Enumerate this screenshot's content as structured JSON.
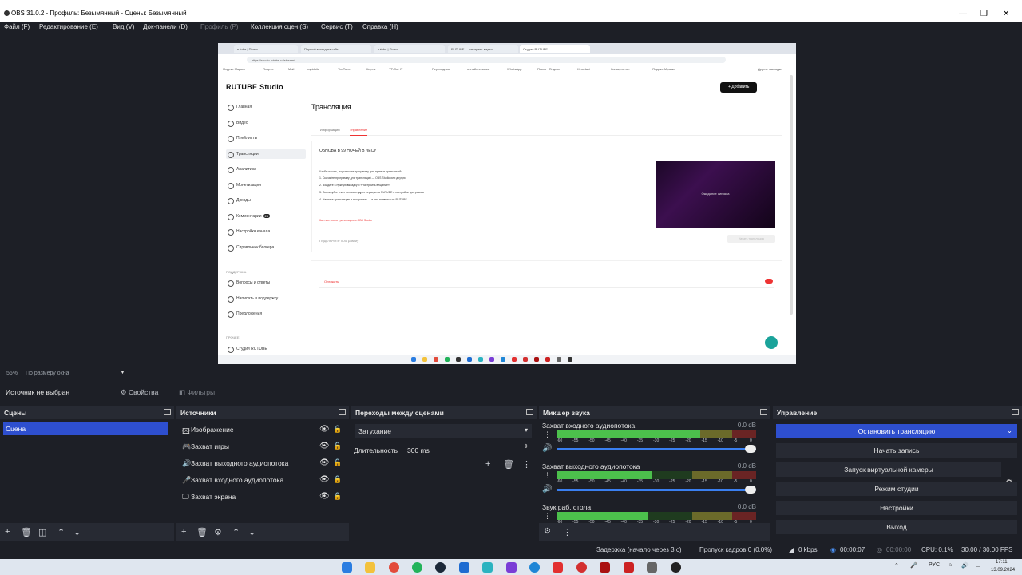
{
  "window": {
    "title": "OBS 31.0.2 - Профиль: Безымянный - Сцены: Безымянный",
    "minimize": "—",
    "maximize": "❐",
    "close": "✕"
  },
  "menu": [
    {
      "label": "Файл (F)",
      "disabled": false
    },
    {
      "label": "Редактирование (E)",
      "disabled": false
    },
    {
      "label": "Вид (V)",
      "disabled": false
    },
    {
      "label": "Док-панели (D)",
      "disabled": false
    },
    {
      "label": "Профиль (P)",
      "disabled": true
    },
    {
      "label": "Коллекция сцен (S)",
      "disabled": false
    },
    {
      "label": "Сервис (T)",
      "disabled": false
    },
    {
      "label": "Справка (H)",
      "disabled": false
    }
  ],
  "capture": {
    "tabs": [
      "rutube | Поиск",
      "Первый взгляд на сайт",
      "rutube | Поиск",
      "RUTUBE — смотреть видео",
      "Студия RUTUBE"
    ],
    "url": "https://studio.rutube.ru/stream/...",
    "bookmarks": [
      "Яндекс Маркет",
      "Яндекс",
      "Mail",
      "rapidsite",
      "YouTube",
      "Карты",
      "YT-Cut·IT",
      "Переводчик",
      "онлайн-ссылка",
      "WhatsApp",
      "Поиск · Яндекс",
      "KinoNavi",
      "Калькулятор",
      "Яндекс Музыка",
      "Другие закладки"
    ],
    "logo": "RUTUBE Studio",
    "add_button": "+ Добавить",
    "nav": [
      {
        "label": "Главная"
      },
      {
        "label": "Видео"
      },
      {
        "label": "Плейлисты"
      },
      {
        "label": "Трансляции"
      },
      {
        "label": "Аналитика"
      },
      {
        "label": "Монетизация"
      },
      {
        "label": "Доходы"
      },
      {
        "label": "Комментарии"
      },
      {
        "label": "Настройки канала"
      },
      {
        "label": "Справочник блогера"
      },
      {
        "label": "Вопросы и ответы"
      },
      {
        "label": "Написать в поддержку"
      },
      {
        "label": "Предложения"
      },
      {
        "label": "Студия RUTUBE"
      }
    ],
    "nav_badge": "24",
    "section_support": "ПОДДЕРЖКА",
    "section_other": "ПРОЧЕЕ",
    "page_title": "Трансляция",
    "subtabs": [
      "Информация",
      "Управление"
    ],
    "card_title": "ОБНОВА В 99 НОЧЕЙ В ЛЕСУ",
    "lines": [
      "Чтобы начать, подключите программу для прямых трансляций:",
      "1. Скачайте программу для трансляций — OBS Studio или другую",
      "2. Войдите в нужную вкладку и «Настроить вещание»",
      "3. Скопируйте ключ потока и адрес сервера из RUTUBE в настройки программы",
      "4. Начните трансляцию в программе — и она появится на RUTUBE"
    ],
    "link": "Как настроить трансляцию в OBS Studio",
    "connect": "Подключите программу",
    "preview_label": "Ожидание сигнала",
    "start_button": "Начать трансляцию",
    "card2_label": "Отложить",
    "card2_toggle": "Вкл"
  },
  "zoom": {
    "percent": "56%",
    "mode": "По размеру окна"
  },
  "source_bar": {
    "none_selected": "Источник не выбран",
    "properties": "Свойства",
    "filters": "Фильтры"
  },
  "scenes": {
    "title": "Сцены",
    "items": [
      "Сцена"
    ]
  },
  "sources": {
    "title": "Источники",
    "items": [
      {
        "label": "Изображение",
        "icon": "image-icon"
      },
      {
        "label": "Захват игры",
        "icon": "gamepad-icon"
      },
      {
        "label": "Захват выходного аудиопотока",
        "icon": "speaker-icon"
      },
      {
        "label": "Захват входного аудиопотока",
        "icon": "microphone-icon"
      },
      {
        "label": "Захват экрана",
        "icon": "monitor-icon"
      }
    ]
  },
  "transitions": {
    "title": "Переходы между сценами",
    "selected": "Затухание",
    "duration_label": "Длительность",
    "duration_value": "300 ms"
  },
  "mixer": {
    "title": "Микшер звука",
    "ticks": [
      "-60",
      "-55",
      "-50",
      "-45",
      "-40",
      "-35",
      "-30",
      "-25",
      "-20",
      "-15",
      "-10",
      "-5",
      "0"
    ],
    "channels": [
      {
        "name": "Захват входного аудиопотока",
        "db": "0.0 dB",
        "level": 0.72
      },
      {
        "name": "Захват выходного аудиопотока",
        "db": "0.0 dB",
        "level": 0.48
      },
      {
        "name": "Звук раб. стола",
        "db": "0.0 dB",
        "level": 0.46
      }
    ]
  },
  "controls": {
    "title": "Управление",
    "stop_stream": "Остановить трансляцию",
    "start_record": "Начать запись",
    "virtual_cam": "Запуск виртуальной камеры",
    "studio_mode": "Режим студии",
    "settings": "Настройки",
    "exit": "Выход"
  },
  "status": {
    "delay": "Задержка (начало через 3 с)",
    "dropped": "Пропуск кадров 0 (0.0%)",
    "bitrate": "0 kbps",
    "stream_time": "00:00:07",
    "rec_time": "00:00:00",
    "cpu": "CPU: 0.1%",
    "fps": "30.00 / 30.00 FPS"
  },
  "taskbar": {
    "lang": "РУС",
    "time": "17:11",
    "date": "13.09.2024"
  }
}
